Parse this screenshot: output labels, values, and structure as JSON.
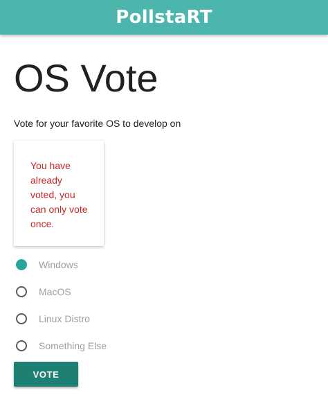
{
  "app_bar": {
    "title": "PollstaRT"
  },
  "page": {
    "title": "OS Vote",
    "subtitle": "Vote for your favorite OS to develop on"
  },
  "error_card": {
    "message": "You have already voted, you can only vote once."
  },
  "options": [
    {
      "label": "Windows",
      "selected": true
    },
    {
      "label": "MacOS",
      "selected": false
    },
    {
      "label": "Linux Distro",
      "selected": false
    },
    {
      "label": "Something Else",
      "selected": false
    }
  ],
  "actions": {
    "vote_label": "VOTE"
  },
  "colors": {
    "app_bar": "#4db6ac",
    "accent": "#26a69a",
    "button": "#1e7f73",
    "error_text": "#c62828"
  }
}
